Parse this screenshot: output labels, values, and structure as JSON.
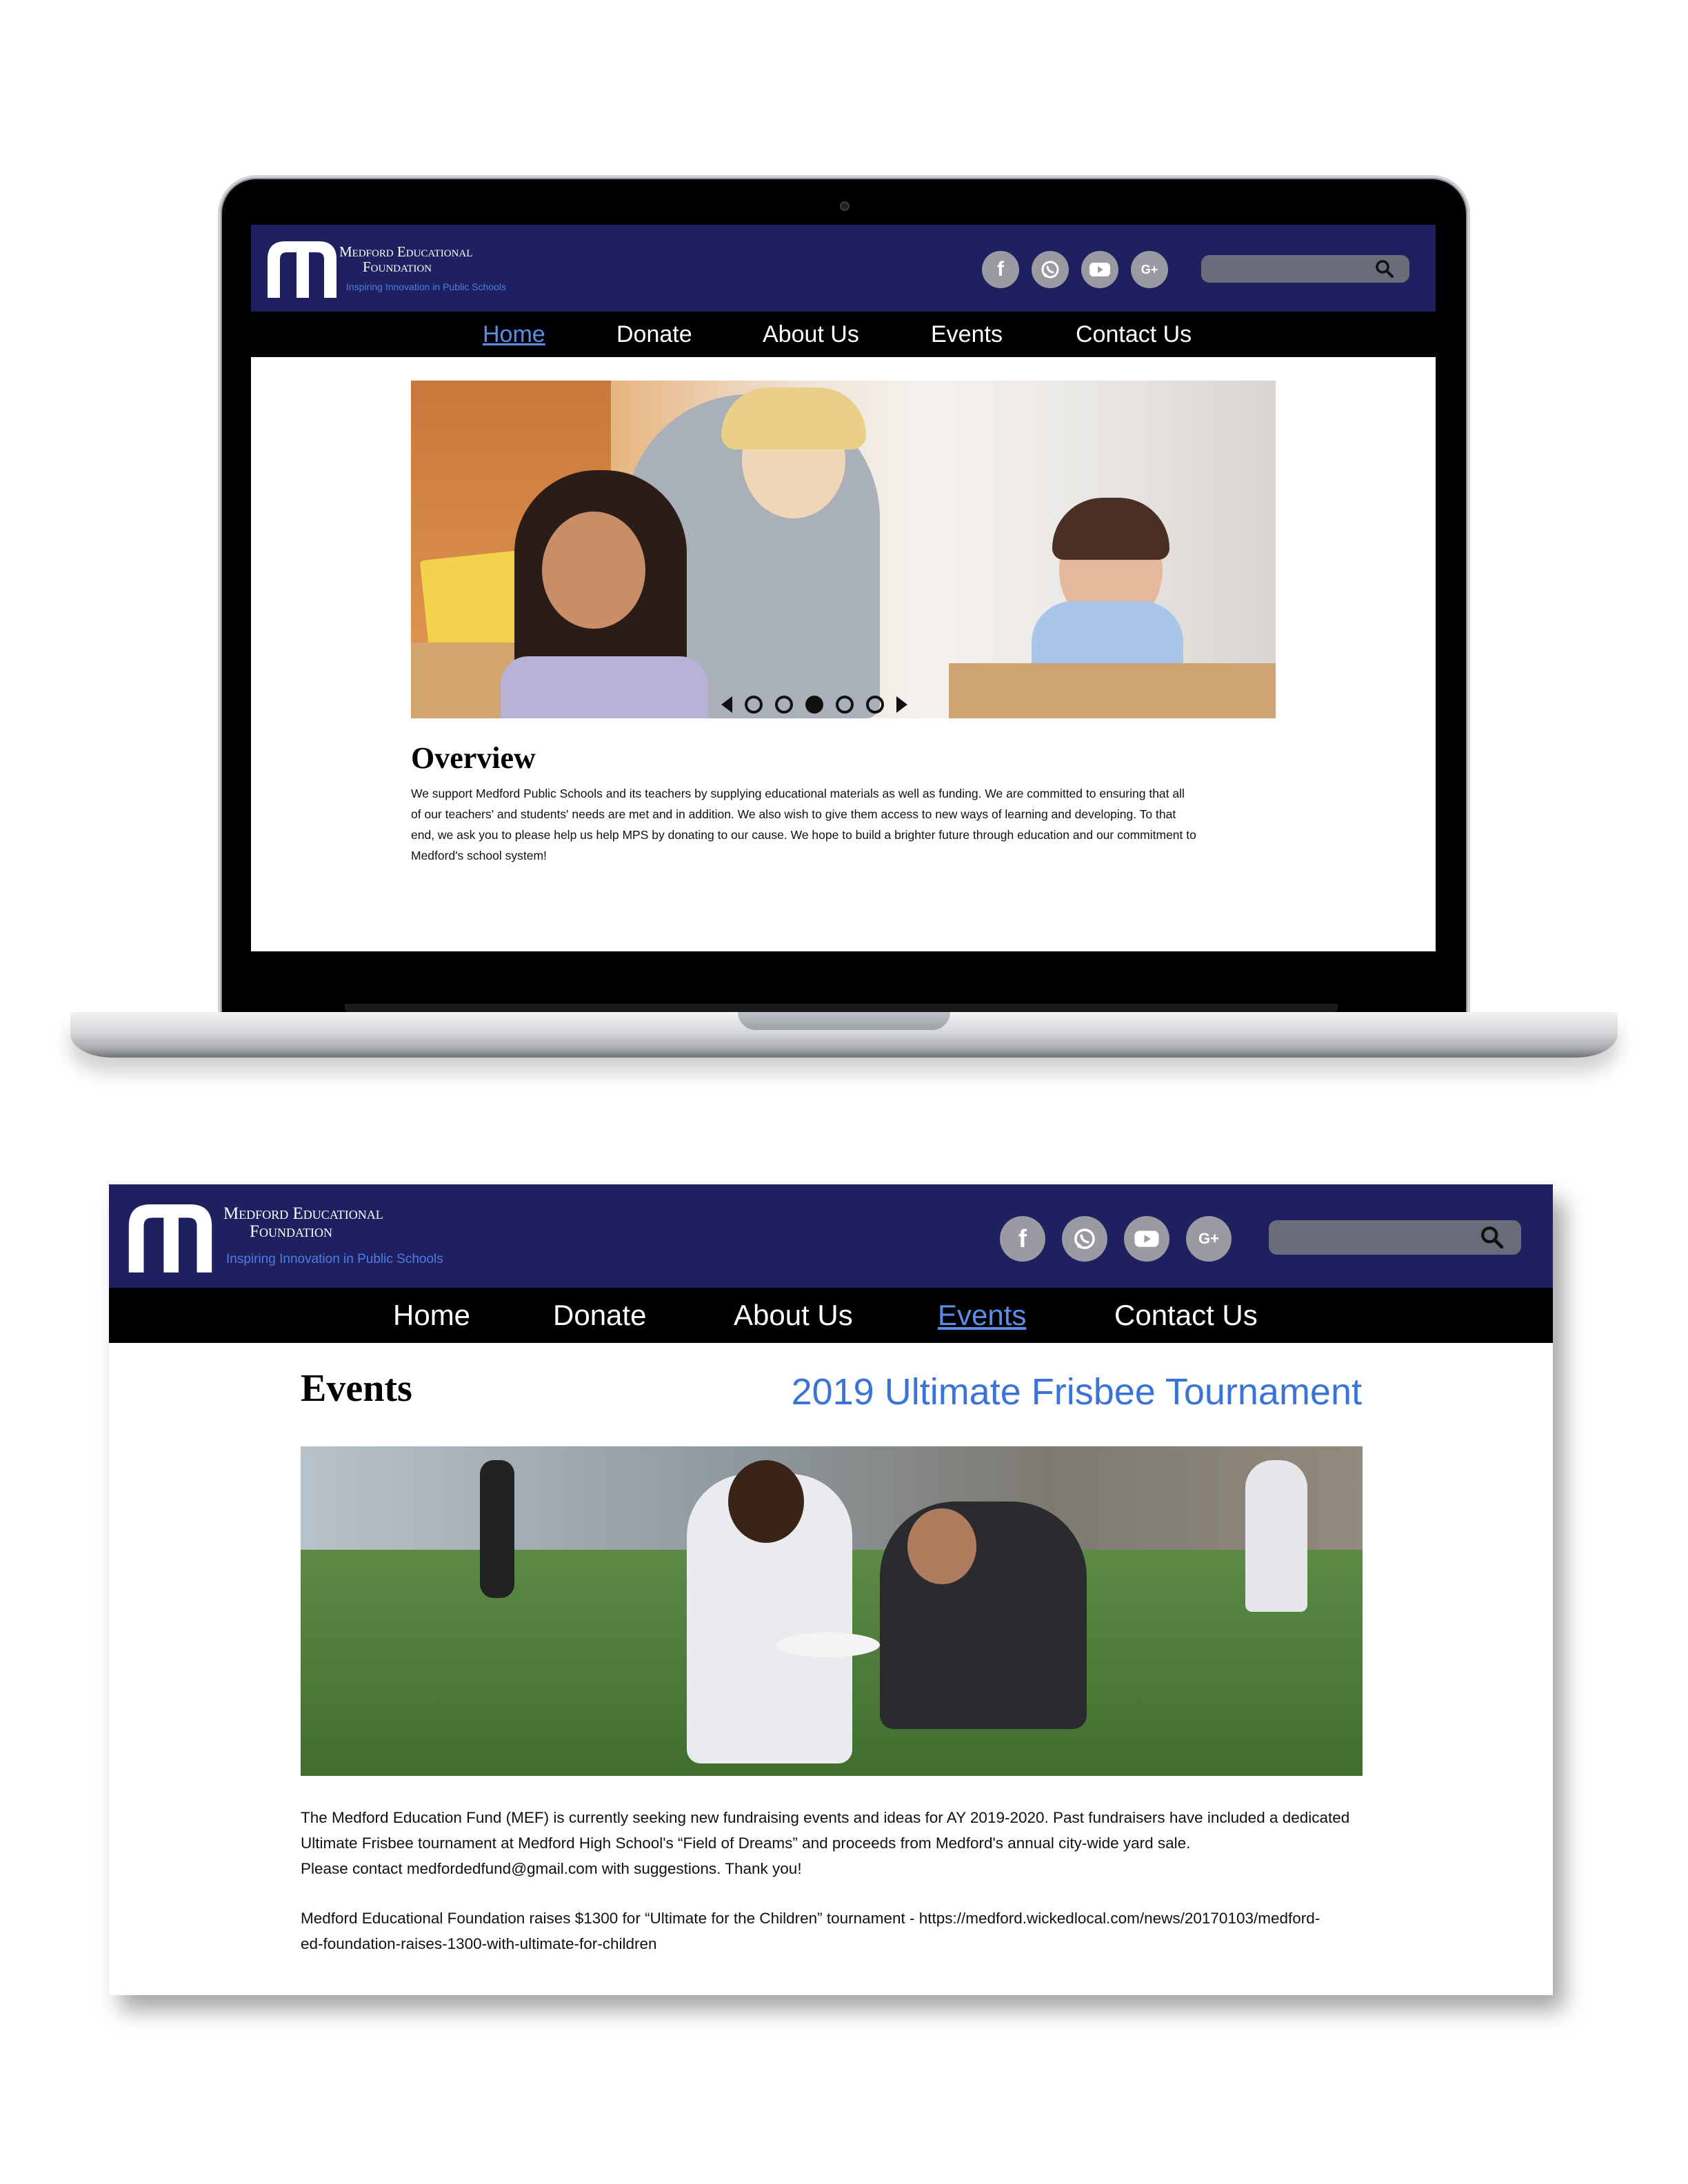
{
  "org": {
    "name_line1": "Medford Educational",
    "name_line2": "Foundation",
    "tagline": "Inspiring Innovation in Public Schools"
  },
  "social_icons": [
    "facebook-icon",
    "whatsapp-icon",
    "youtube-icon",
    "google-plus-icon"
  ],
  "social_glyphs": {
    "facebook": "f",
    "google_plus": "G+"
  },
  "nav": {
    "home": "Home",
    "donate": "Donate",
    "about": "About Us",
    "events": "Events",
    "contact": "Contact Us"
  },
  "home_page": {
    "active_nav": "Home",
    "carousel": {
      "slide_count": 5,
      "active_slide": 3
    },
    "overview_title": "Overview",
    "overview_lines": [
      "We support Medford Public Schools and its teachers by supplying educational materials as well as funding. We are committed to ensuring that all",
      "of our teachers' and students' needs are met and in addition. We also wish to give them access to new ways of learning and developing. To that",
      "end, we ask you to please help us help MPS by donating to our cause. We hope to build a brighter future through education and our commitment to",
      "Medford's school system!"
    ]
  },
  "events_page": {
    "active_nav": "Events",
    "title": "Events",
    "event_heading": "2019 Ultimate Frisbee Tournament",
    "para1_lines": [
      "The Medford Education Fund (MEF) is currently seeking new fundraising events and ideas for AY 2019-2020.  Past fundraisers have included a dedicated",
      "Ultimate Frisbee tournament at Medford High School's “Field of Dreams” and proceeds from Medford's annual city-wide yard sale.",
      "Please contact medfordedfund@gmail.com with suggestions.  Thank you!"
    ],
    "para2_lines": [
      "Medford Educational Foundation raises $1300 for “Ultimate for the Children” tournament - https://medford.wickedlocal.com/news/20170103/medford-",
      "ed-foundation-raises-1300-with-ultimate-for-children"
    ]
  },
  "colors": {
    "header_bg": "#1f2060",
    "nav_bg": "#000000",
    "active_link": "#5b8de6",
    "event_heading": "#3a74d6",
    "tagline": "#4f7de0"
  }
}
